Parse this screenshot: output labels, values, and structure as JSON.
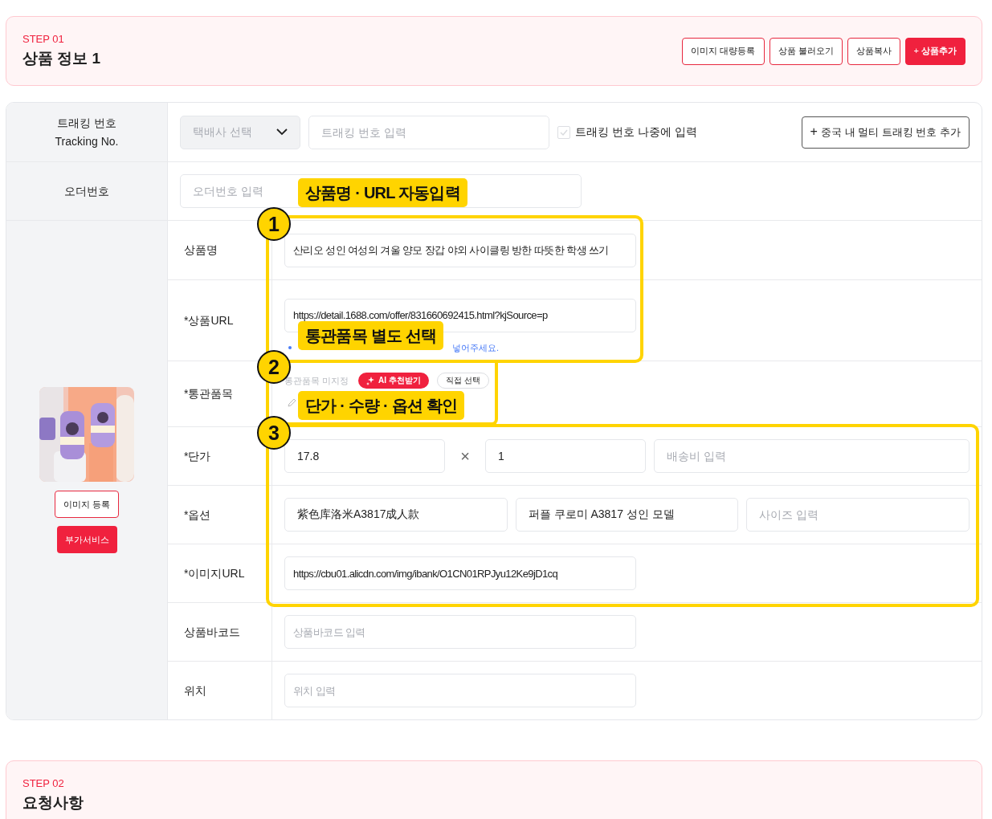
{
  "step1": {
    "step": "STEP 01",
    "title": "상품 정보 1",
    "buttons": [
      {
        "label": "이미지 대량등록",
        "kind": "outline"
      },
      {
        "label": "상품 불러오기",
        "kind": "outline"
      },
      {
        "label": "상품복사",
        "kind": "outline"
      },
      {
        "label": "상품추가",
        "kind": "primary",
        "icon": "+"
      }
    ]
  },
  "tracking": {
    "label": "트래킹 번호",
    "sublabel": "Tracking No.",
    "courier_placeholder": "택배사 선택",
    "number_placeholder": "트래킹 번호 입력",
    "later": {
      "label": "트래킹 번호 나중에 입력",
      "checked": false
    },
    "add_button": "중국 내 멀티 트래킹 번호 추가"
  },
  "order": {
    "label": "오더번호",
    "placeholder": "오더번호 입력"
  },
  "product": {
    "image_button": "이미지 등록",
    "service_button": "부가서비스",
    "rows": [
      {
        "label": "상품명",
        "kind": "single",
        "fields": [
          {
            "value": "산리오 성인 여성의 겨울 양모 장갑 야외 사이클링 방한 따뜻한 학생 쓰기"
          }
        ]
      },
      {
        "label": "*상품URL",
        "kind": "url",
        "fields": [
          {
            "value": "https://detail.1688.com/offer/831660692415.html?kjSource=p"
          }
        ],
        "hint": "넣어주세요."
      },
      {
        "label": "*통관품목",
        "kind": "customs",
        "status": "통관품목 미지정",
        "ai_button": "AI 추천받기",
        "manual_button": "직접 선택"
      },
      {
        "label": "*단가",
        "kind": "price",
        "fields": [
          {
            "value": "17.8"
          },
          {
            "value": "1"
          },
          {
            "placeholder": "배송비 입력"
          }
        ],
        "operator": "×"
      },
      {
        "label": "*옵션",
        "kind": "triple",
        "fields": [
          {
            "value": "紫色库洛米A3817成人款"
          },
          {
            "value": "퍼플 쿠로미 A3817 성인 모델"
          },
          {
            "placeholder": "사이즈 입력"
          }
        ]
      },
      {
        "label": "*이미지URL",
        "kind": "single",
        "fields": [
          {
            "value": "https://cbu01.alicdn.com/img/ibank/O1CN01RPJyu12Ke9jD1cq"
          }
        ]
      },
      {
        "label": "상품바코드",
        "kind": "single",
        "fields": [
          {
            "placeholder": "상품바코드 입력"
          }
        ]
      },
      {
        "label": "위치",
        "kind": "single",
        "fields": [
          {
            "placeholder": "위치 입력"
          }
        ]
      }
    ]
  },
  "annotations": [
    {
      "number": "1",
      "label": "상품명 · URL 자동입력"
    },
    {
      "number": "2",
      "label": "통관품목 별도 선택"
    },
    {
      "number": "3",
      "label": "단가 · 수량 · 옵션 확인"
    }
  ],
  "step2": {
    "step": "STEP 02",
    "title": "요청사항"
  }
}
